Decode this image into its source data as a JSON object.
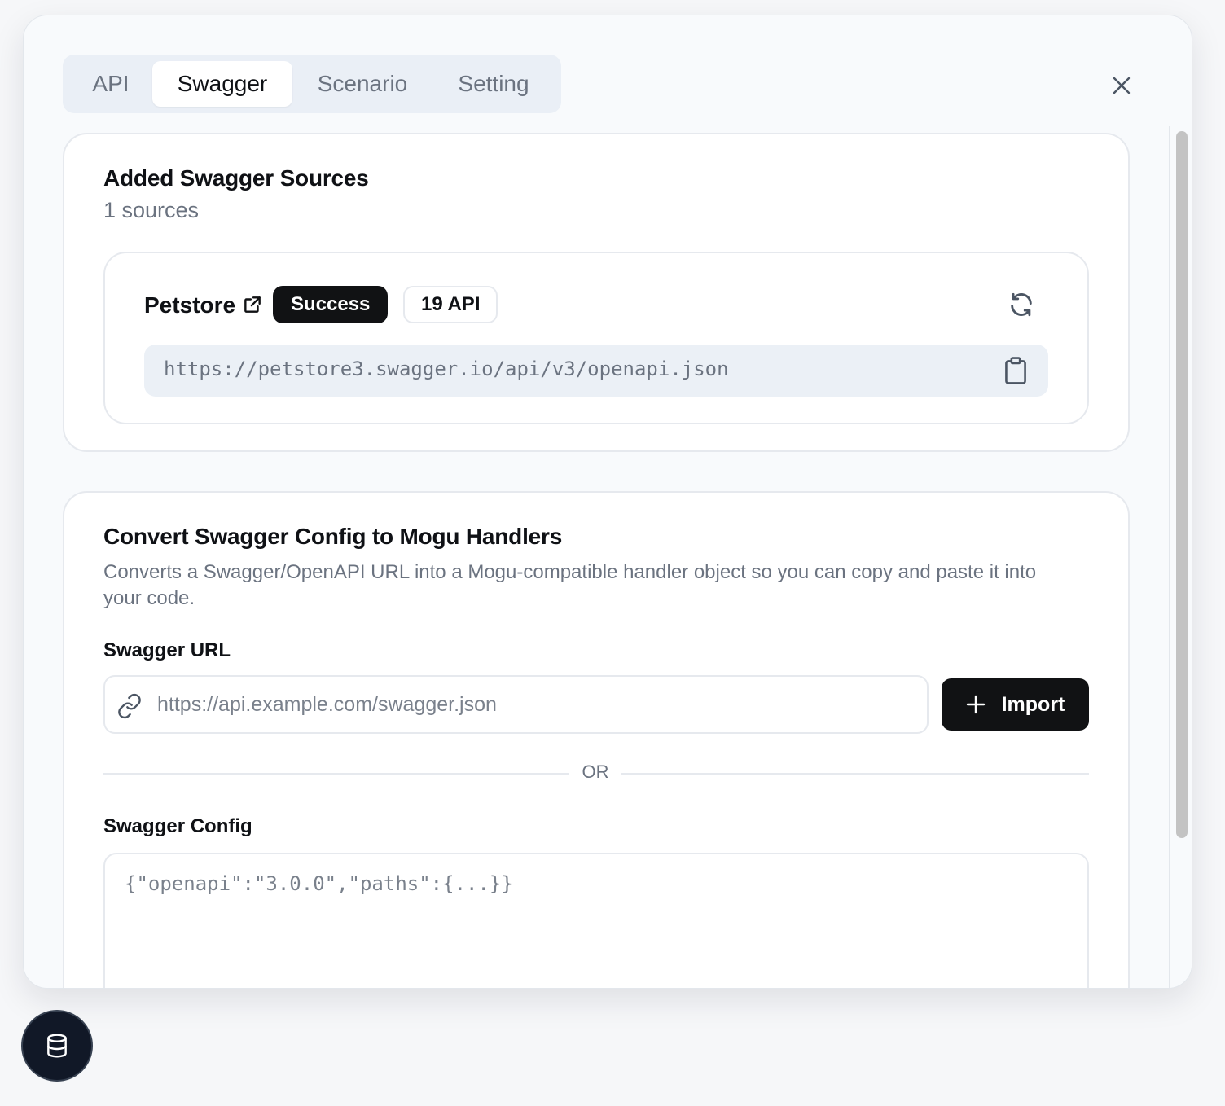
{
  "tabs": [
    {
      "label": "API",
      "active": false
    },
    {
      "label": "Swagger",
      "active": true
    },
    {
      "label": "Scenario",
      "active": false
    },
    {
      "label": "Setting",
      "active": false
    }
  ],
  "sources": {
    "title": "Added Swagger Sources",
    "count_text": "1 sources",
    "items": [
      {
        "name": "Petstore",
        "status": "Success",
        "api_count": "19 API",
        "url": "https://petstore3.swagger.io/api/v3/openapi.json"
      }
    ]
  },
  "convert": {
    "title": "Convert Swagger Config to Mogu Handlers",
    "description": "Converts a Swagger/OpenAPI URL into a Mogu-compatible handler object so you can copy and paste it into your code.",
    "url_label": "Swagger URL",
    "url_placeholder": "https://api.example.com/swagger.json",
    "url_value": "",
    "import_label": "Import",
    "or_text": "OR",
    "config_label": "Swagger Config",
    "config_placeholder": "{\"openapi\":\"3.0.0\",\"paths\":{...}}",
    "config_value": ""
  },
  "icons": {
    "close": "close-icon",
    "external_link": "external-link-icon",
    "refresh": "refresh-icon",
    "copy": "clipboard-icon",
    "link": "link-icon",
    "plus": "plus-icon",
    "database": "database-icon"
  },
  "colors": {
    "accent_dark": "#111214",
    "muted_text": "#6b7380",
    "tab_bg": "#eaeff6",
    "url_bg": "#ebf0f6"
  }
}
